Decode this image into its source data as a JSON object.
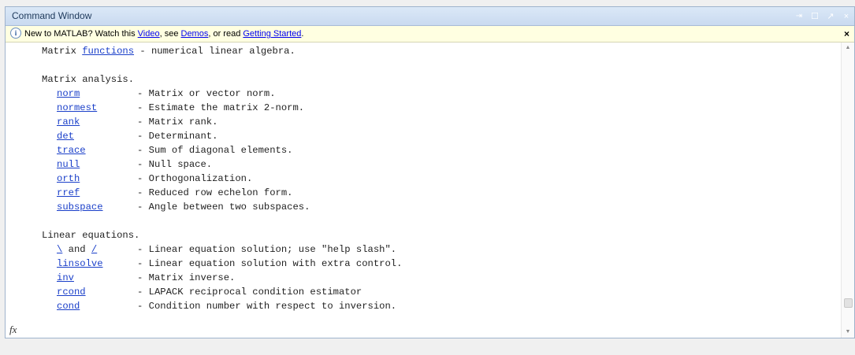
{
  "window": {
    "title": "Command Window",
    "controls": [
      "⇥",
      "☐",
      "↗",
      "×"
    ]
  },
  "infobar": {
    "prefix": "New to MATLAB? Watch this ",
    "video": "Video",
    "mid1": ", see ",
    "demos": "Demos",
    "mid2": ", or read ",
    "getting_started": "Getting Started",
    "suffix": ".",
    "close": "×"
  },
  "console": {
    "header_pre": "Matrix ",
    "header_link": "functions",
    "header_post": " - numerical linear algebra.",
    "section1": "Matrix analysis.",
    "analysis": [
      {
        "fn": "norm",
        "desc": "- Matrix or vector norm."
      },
      {
        "fn": "normest",
        "desc": "- Estimate the matrix 2-norm."
      },
      {
        "fn": "rank",
        "desc": "- Matrix rank."
      },
      {
        "fn": "det",
        "desc": "- Determinant."
      },
      {
        "fn": "trace",
        "desc": "- Sum of diagonal elements."
      },
      {
        "fn": "null",
        "desc": "- Null space."
      },
      {
        "fn": "orth",
        "desc": "- Orthogonalization."
      },
      {
        "fn": "rref",
        "desc": "- Reduced row echelon form."
      },
      {
        "fn": "subspace",
        "desc": "- Angle between two subspaces."
      }
    ],
    "section2": "Linear equations.",
    "slash": {
      "a": "\\",
      "and": " and ",
      "b": "/",
      "desc": "- Linear equation solution; use \"help slash\"."
    },
    "equations": [
      {
        "fn": "linsolve",
        "desc": "- Linear equation solution with extra control."
      },
      {
        "fn": "inv",
        "desc": "- Matrix inverse."
      },
      {
        "fn": "rcond",
        "desc": "- LAPACK reciprocal condition estimator"
      },
      {
        "fn": "cond",
        "desc": "- Condition number with respect to inversion."
      }
    ]
  },
  "fx_label": "fx"
}
